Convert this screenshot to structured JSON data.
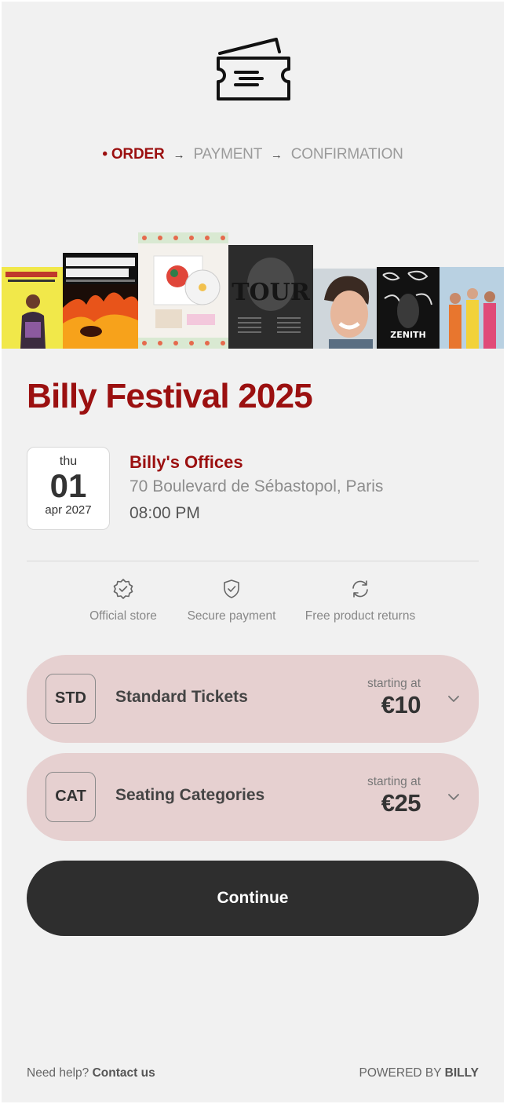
{
  "steps": [
    {
      "label": "ORDER",
      "prefix": "• "
    },
    {
      "label": "PAYMENT"
    },
    {
      "label": "CONFIRMATION"
    }
  ],
  "step_arrow": "→",
  "event": {
    "title": "Billy Festival 2025",
    "date": {
      "weekday": "thu",
      "day": "01",
      "month_year": "apr 2027"
    },
    "venue": "Billy's Offices",
    "address": "70 Boulevard de Sébastopol, Paris",
    "time": "08:00 PM"
  },
  "banner": {
    "covers": [
      {
        "title": "MC SOLAAR",
        "color": "#f1e84a"
      },
      {
        "title": "BLACKBIRD EXPERIENCE",
        "color": "#b8300e"
      },
      {
        "title": "album-bundle",
        "color": "#f4f1ec"
      },
      {
        "title": "TOUR",
        "color": "#2c2c2c"
      },
      {
        "title": "portrait",
        "color": "#cfd6db"
      },
      {
        "title": "ZENITH",
        "color": "#121212"
      },
      {
        "title": "group",
        "color": "#9bbfd7"
      }
    ]
  },
  "features": [
    {
      "label": "Official store",
      "icon": "verified-badge-icon"
    },
    {
      "label": "Secure payment",
      "icon": "shield-check-icon"
    },
    {
      "label": "Free product returns",
      "icon": "refresh-icon"
    }
  ],
  "tickets": [
    {
      "code": "STD",
      "name": "Standard Tickets",
      "starting_label": "starting at",
      "price": "€10"
    },
    {
      "code": "CAT",
      "name": "Seating Categories",
      "starting_label": "starting at",
      "price": "€25"
    }
  ],
  "continue_label": "Continue",
  "footer": {
    "help_prefix": "Need help?",
    "help_link": "Contact us",
    "powered_prefix": "POWERED BY",
    "powered_brand": "BILLY"
  },
  "colors": {
    "brand": "#9b1010",
    "ticket_bg": "#e6d0d0",
    "button_bg": "#2e2e2e",
    "page_bg": "#f1f1f1"
  }
}
